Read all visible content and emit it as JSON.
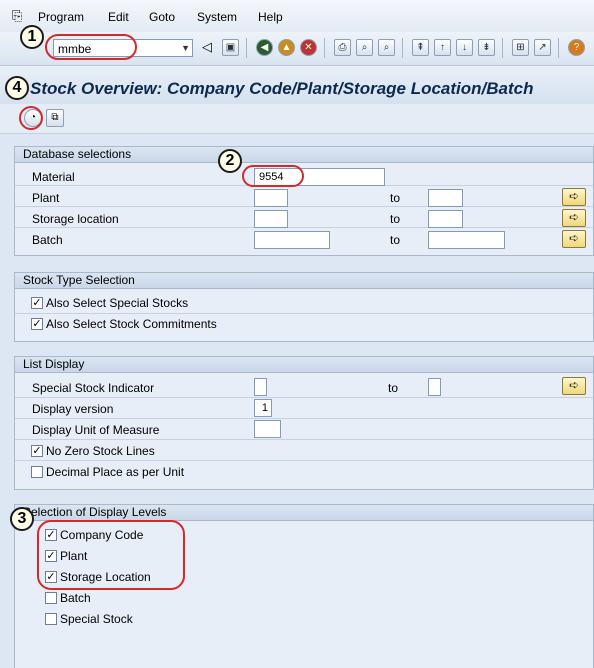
{
  "menu": {
    "items": [
      "Program",
      "Edit",
      "Goto",
      "System",
      "Help"
    ]
  },
  "toolbar": {
    "command_value": "mmbe",
    "icons": [
      "enter-icon",
      "save-icon",
      "back-icon",
      "exit-icon",
      "cancel-icon",
      "print-icon",
      "find-icon",
      "find-next-icon",
      "first-page-icon",
      "prev-page-icon",
      "next-page-icon",
      "last-page-icon",
      "new-session-icon",
      "shortcut-icon",
      "help-icon",
      "layout-icon"
    ]
  },
  "title": "Stock Overview: Company Code/Plant/Storage Location/Batch",
  "appbar": {
    "icons": [
      "execute-icon",
      "get-variant-icon"
    ]
  },
  "database_selections": {
    "title": "Database selections",
    "material_label": "Material",
    "material_value": "9554",
    "plant_label": "Plant",
    "storage_location_label": "Storage location",
    "batch_label": "Batch",
    "to_label": "to"
  },
  "stock_type": {
    "title": "Stock Type Selection",
    "special_stocks": {
      "label": "Also Select Special Stocks",
      "checked": true
    },
    "stock_commitments": {
      "label": "Also Select Stock Commitments",
      "checked": true
    }
  },
  "list_display": {
    "title": "List Display",
    "special_stock_indicator_label": "Special Stock Indicator",
    "to_label": "to",
    "display_version_label": "Display version",
    "display_version_value": "1",
    "display_uom_label": "Display Unit of Measure",
    "no_zero_stock": {
      "label": "No Zero Stock Lines",
      "checked": true
    },
    "decimal_place": {
      "label": "Decimal Place as per Unit",
      "checked": false
    }
  },
  "display_levels": {
    "title": "Selection of Display Levels",
    "company_code": {
      "label": "Company Code",
      "checked": true
    },
    "plant": {
      "label": "Plant",
      "checked": true
    },
    "storage_location": {
      "label": "Storage Location",
      "checked": true
    },
    "batch": {
      "label": "Batch",
      "checked": false
    },
    "special_stock": {
      "label": "Special Stock",
      "checked": false
    }
  },
  "markers": [
    "1",
    "2",
    "3",
    "4"
  ],
  "colors": {
    "background": "#dde7f3",
    "title_text": "#0c2a4e",
    "annotation_ring": "#d42a2a"
  }
}
